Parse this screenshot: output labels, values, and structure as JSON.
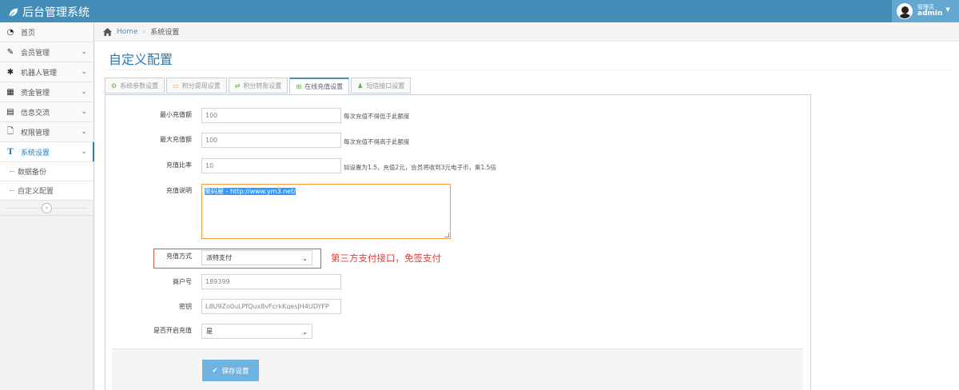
{
  "app": {
    "title": "后台管理系统"
  },
  "user": {
    "role": "管理员",
    "name": "admin"
  },
  "sidebar": {
    "items": [
      {
        "label": "首页",
        "icon": "dashboard-icon"
      },
      {
        "label": "会员管理",
        "icon": "edit-icon"
      },
      {
        "label": "机器人管理",
        "icon": "asterisk-icon"
      },
      {
        "label": "资金管理",
        "icon": "calendar-icon"
      },
      {
        "label": "信息交流",
        "icon": "list-icon"
      },
      {
        "label": "权限管理",
        "icon": "file-icon"
      },
      {
        "label": "系统设置",
        "icon": "text-icon"
      }
    ],
    "subitems": [
      {
        "label": "数据备份"
      },
      {
        "label": "自定义配置"
      }
    ]
  },
  "breadcrumb": {
    "home": "Home",
    "current": "系统设置"
  },
  "page": {
    "title": "自定义配置"
  },
  "tabs": [
    {
      "label": "系统参数设置",
      "icon": "cogs-icon"
    },
    {
      "label": "积分提现设置",
      "icon": "card-icon"
    },
    {
      "label": "积分转账设置",
      "icon": "exchange-icon"
    },
    {
      "label": "在线充值设置",
      "icon": "plus-square-icon",
      "active": true
    },
    {
      "label": "短信接口设置",
      "icon": "user-icon"
    }
  ],
  "form": {
    "min_recharge": {
      "label": "最小充值额",
      "value": "100",
      "help": "每次充值不得低于此额度"
    },
    "max_recharge": {
      "label": "最大充值额",
      "value": "100",
      "help": "每次充值不得高于此额度"
    },
    "ratio": {
      "label": "充值比率",
      "value": "10",
      "help": "如设置为1.5，充值2元，会员将收到3元电子币，乘1.5倍"
    },
    "description": {
      "label": "充值说明",
      "value": "聚码屋 - http://www.ym3.net/"
    },
    "method": {
      "label": "充值方式",
      "value": "派特支付"
    },
    "merchant": {
      "label": "商户号",
      "value": "189399"
    },
    "secret": {
      "label": "密钥",
      "value": "L8U9Zo0uLPfQux8vFcrkKqesJH4UDYFP"
    },
    "enabled": {
      "label": "是否开启充值",
      "value": "是"
    }
  },
  "annotation": "第三方支付接口，免签支付",
  "actions": {
    "save_label": "保存设置"
  },
  "colors": {
    "navbar": "#438eb9",
    "accent": "#2679b5",
    "button": "#6fb3e0",
    "annotation": "#e53a37"
  }
}
